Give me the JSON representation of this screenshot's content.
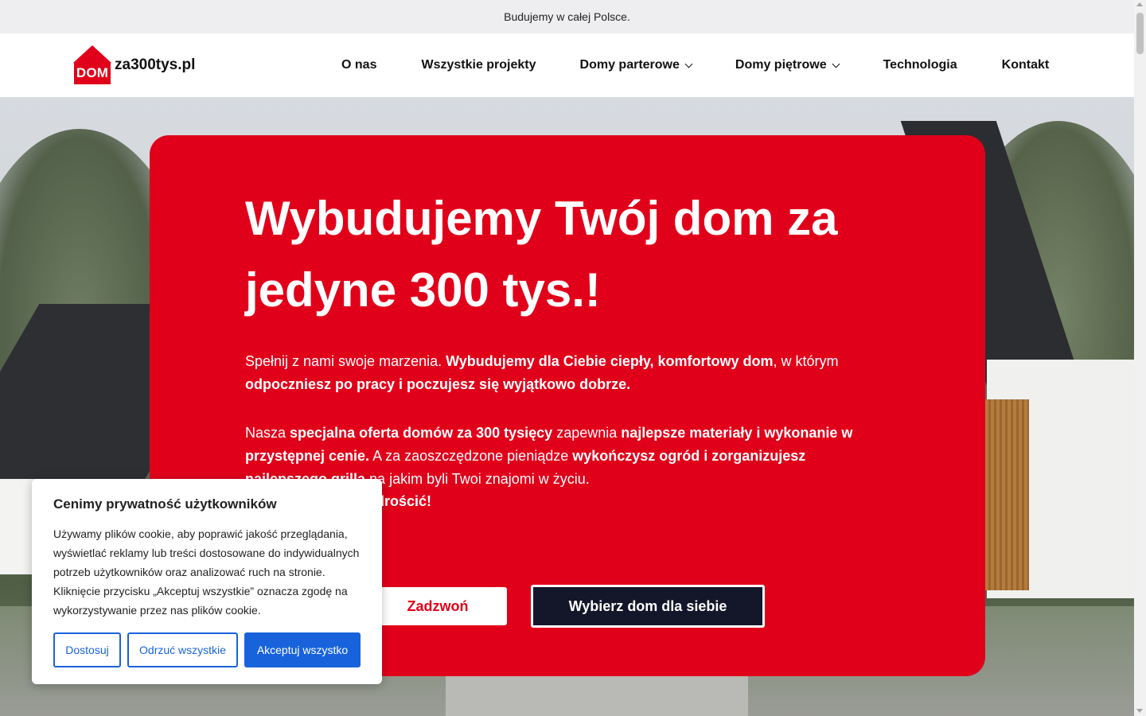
{
  "topbar": {
    "text": "Budujemy w całej Polsce."
  },
  "logo": {
    "badge": "DOM",
    "text": "za300tys.pl"
  },
  "nav": {
    "items": [
      {
        "label": "O nas",
        "dropdown": false
      },
      {
        "label": "Wszystkie projekty",
        "dropdown": false
      },
      {
        "label": "Domy parterowe",
        "dropdown": true
      },
      {
        "label": "Domy piętrowe",
        "dropdown": true
      },
      {
        "label": "Technologia",
        "dropdown": false
      },
      {
        "label": "Kontakt",
        "dropdown": false
      }
    ]
  },
  "hero": {
    "title": "Wybudujemy Twój dom za jedyne 300 tys.!",
    "p1": {
      "t1": "Spełnij z nami swoje marzenia. ",
      "b1": "Wybudujemy dla Ciebie ciepły, komfortowy dom",
      "t2": ", w którym ",
      "b2": "odpoczniesz po pracy i poczujesz się wyjątkowo dobrze."
    },
    "p2": {
      "t1": "Nasza ",
      "b1": "specjalna oferta domów za 300 tysięcy",
      "t2": " zapewnia ",
      "b2": "najlepsze materiały i wykonanie w przystępnej cenie.",
      "t3": " A za zaoszczędzone pieniądze ",
      "b3": "wykończysz ogród i zorganizujesz najlepszego grilla",
      "t4": " na jakim byli Twoi znajomi w życiu."
    },
    "p3": "drościć!",
    "call_button": "Zadzwoń",
    "choose_button": "Wybierz dom dla siebie"
  },
  "cookie": {
    "title": "Cenimy prywatność użytkowników",
    "text": "Używamy plików cookie, aby poprawić jakość przeglądania, wyświetlać reklamy lub treści dostosowane do indywidualnych potrzeb użytkowników oraz analizować ruch na stronie. Kliknięcie przycisku „Akceptuj wszystkie” oznacza zgodę na wykorzystywanie przez nas plików cookie.",
    "customize_button": "Dostosuj",
    "reject_button": "Odrzuć wszystkie",
    "accept_button": "Akceptuj wszystko"
  },
  "colors": {
    "brand_red": "#e1001a",
    "dark_button": "#14172a",
    "cookie_blue": "#1863dc"
  }
}
